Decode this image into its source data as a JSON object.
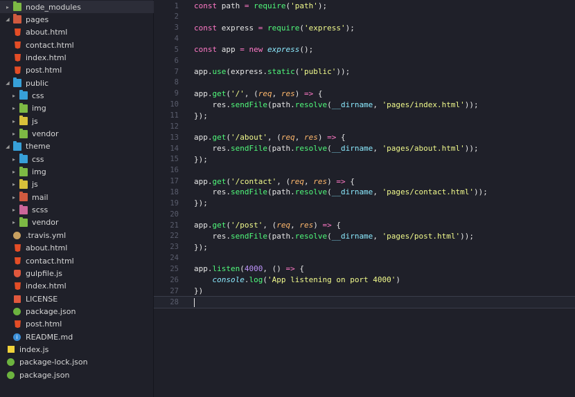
{
  "tree": [
    {
      "name": "node_modules",
      "type": "folder",
      "color": "green",
      "depth": 0,
      "expanded": false,
      "selected": true
    },
    {
      "name": "pages",
      "type": "folder",
      "color": "red",
      "depth": 0,
      "expanded": true
    },
    {
      "name": "about.html",
      "type": "html",
      "depth": 1
    },
    {
      "name": "contact.html",
      "type": "html",
      "depth": 1
    },
    {
      "name": "index.html",
      "type": "html",
      "depth": 1
    },
    {
      "name": "post.html",
      "type": "html",
      "depth": 1
    },
    {
      "name": "public",
      "type": "folder",
      "color": "blue",
      "depth": 0,
      "expanded": true
    },
    {
      "name": "css",
      "type": "folder",
      "color": "blue",
      "depth": 1,
      "expanded": false
    },
    {
      "name": "img",
      "type": "folder",
      "color": "green",
      "depth": 1,
      "expanded": false
    },
    {
      "name": "js",
      "type": "folder",
      "color": "yellow",
      "depth": 1,
      "expanded": false
    },
    {
      "name": "vendor",
      "type": "folder",
      "color": "green",
      "depth": 1,
      "expanded": false
    },
    {
      "name": "theme",
      "type": "folder",
      "color": "blue",
      "depth": 0,
      "expanded": true
    },
    {
      "name": "css",
      "type": "folder",
      "color": "blue",
      "depth": 1,
      "expanded": false
    },
    {
      "name": "img",
      "type": "folder",
      "color": "green",
      "depth": 1,
      "expanded": false
    },
    {
      "name": "js",
      "type": "folder",
      "color": "yellow",
      "depth": 1,
      "expanded": false
    },
    {
      "name": "mail",
      "type": "folder",
      "color": "red",
      "depth": 1,
      "expanded": false
    },
    {
      "name": "scss",
      "type": "folder",
      "color": "pink",
      "depth": 1,
      "expanded": false
    },
    {
      "name": "vendor",
      "type": "folder",
      "color": "green",
      "depth": 1,
      "expanded": false
    },
    {
      "name": ".travis.yml",
      "type": "travis",
      "depth": 1
    },
    {
      "name": "about.html",
      "type": "html",
      "depth": 1
    },
    {
      "name": "contact.html",
      "type": "html",
      "depth": 1
    },
    {
      "name": "gulpfile.js",
      "type": "gulp",
      "depth": 1
    },
    {
      "name": "index.html",
      "type": "html",
      "depth": 1
    },
    {
      "name": "LICENSE",
      "type": "license",
      "depth": 1
    },
    {
      "name": "package.json",
      "type": "json",
      "depth": 1
    },
    {
      "name": "post.html",
      "type": "html",
      "depth": 1
    },
    {
      "name": "README.md",
      "type": "info",
      "depth": 1
    },
    {
      "name": "index.js",
      "type": "js",
      "depth": 0
    },
    {
      "name": "package-lock.json",
      "type": "json",
      "depth": 0
    },
    {
      "name": "package.json",
      "type": "json",
      "depth": 0
    }
  ],
  "code_lines": [
    [
      [
        "kw",
        "const"
      ],
      [
        "pl",
        " path "
      ],
      [
        "op",
        "="
      ],
      [
        "pl",
        " "
      ],
      [
        "fn",
        "require"
      ],
      [
        "pl",
        "("
      ],
      [
        "str",
        "'path'"
      ],
      [
        "pl",
        ");"
      ]
    ],
    [],
    [
      [
        "kw",
        "const"
      ],
      [
        "pl",
        " express "
      ],
      [
        "op",
        "="
      ],
      [
        "pl",
        " "
      ],
      [
        "fn",
        "require"
      ],
      [
        "pl",
        "("
      ],
      [
        "str",
        "'express'"
      ],
      [
        "pl",
        ");"
      ]
    ],
    [],
    [
      [
        "kw",
        "const"
      ],
      [
        "pl",
        " app "
      ],
      [
        "op",
        "="
      ],
      [
        "pl",
        " "
      ],
      [
        "kw",
        "new"
      ],
      [
        "pl",
        " "
      ],
      [
        "cls",
        "express"
      ],
      [
        "pl",
        "();"
      ]
    ],
    [],
    [
      [
        "pl",
        "app."
      ],
      [
        "fn",
        "use"
      ],
      [
        "pl",
        "(express."
      ],
      [
        "fn",
        "static"
      ],
      [
        "pl",
        "("
      ],
      [
        "str",
        "'public'"
      ],
      [
        "pl",
        "));"
      ]
    ],
    [],
    [
      [
        "pl",
        "app."
      ],
      [
        "fn",
        "get"
      ],
      [
        "pl",
        "("
      ],
      [
        "str",
        "'/'"
      ],
      [
        "pl",
        ", ("
      ],
      [
        "param",
        "req"
      ],
      [
        "pl",
        ", "
      ],
      [
        "param",
        "res"
      ],
      [
        "pl",
        ") "
      ],
      [
        "op",
        "=>"
      ],
      [
        "pl",
        " {"
      ]
    ],
    [
      [
        "pl",
        "    res."
      ],
      [
        "fn",
        "sendFile"
      ],
      [
        "pl",
        "(path."
      ],
      [
        "fn",
        "resolve"
      ],
      [
        "pl",
        "("
      ],
      [
        "key",
        "__dirname"
      ],
      [
        "pl",
        ", "
      ],
      [
        "str",
        "'pages/index.html'"
      ],
      [
        "pl",
        "));"
      ]
    ],
    [
      [
        "pl",
        "});"
      ]
    ],
    [],
    [
      [
        "pl",
        "app."
      ],
      [
        "fn",
        "get"
      ],
      [
        "pl",
        "("
      ],
      [
        "str",
        "'/about'"
      ],
      [
        "pl",
        ", ("
      ],
      [
        "param",
        "req"
      ],
      [
        "pl",
        ", "
      ],
      [
        "param",
        "res"
      ],
      [
        "pl",
        ") "
      ],
      [
        "op",
        "=>"
      ],
      [
        "pl",
        " {"
      ]
    ],
    [
      [
        "pl",
        "    res."
      ],
      [
        "fn",
        "sendFile"
      ],
      [
        "pl",
        "(path."
      ],
      [
        "fn",
        "resolve"
      ],
      [
        "pl",
        "("
      ],
      [
        "key",
        "__dirname"
      ],
      [
        "pl",
        ", "
      ],
      [
        "str",
        "'pages/about.html'"
      ],
      [
        "pl",
        "));"
      ]
    ],
    [
      [
        "pl",
        "});"
      ]
    ],
    [],
    [
      [
        "pl",
        "app."
      ],
      [
        "fn",
        "get"
      ],
      [
        "pl",
        "("
      ],
      [
        "str",
        "'/contact'"
      ],
      [
        "pl",
        ", ("
      ],
      [
        "param",
        "req"
      ],
      [
        "pl",
        ", "
      ],
      [
        "param",
        "res"
      ],
      [
        "pl",
        ") "
      ],
      [
        "op",
        "=>"
      ],
      [
        "pl",
        " {"
      ]
    ],
    [
      [
        "pl",
        "    res."
      ],
      [
        "fn",
        "sendFile"
      ],
      [
        "pl",
        "(path."
      ],
      [
        "fn",
        "resolve"
      ],
      [
        "pl",
        "("
      ],
      [
        "key",
        "__dirname"
      ],
      [
        "pl",
        ", "
      ],
      [
        "str",
        "'pages/contact.html'"
      ],
      [
        "pl",
        "));"
      ]
    ],
    [
      [
        "pl",
        "});"
      ]
    ],
    [],
    [
      [
        "pl",
        "app."
      ],
      [
        "fn",
        "get"
      ],
      [
        "pl",
        "("
      ],
      [
        "str",
        "'/post'"
      ],
      [
        "pl",
        ", ("
      ],
      [
        "param",
        "req"
      ],
      [
        "pl",
        ", "
      ],
      [
        "param",
        "res"
      ],
      [
        "pl",
        ") "
      ],
      [
        "op",
        "=>"
      ],
      [
        "pl",
        " {"
      ]
    ],
    [
      [
        "pl",
        "    res."
      ],
      [
        "fn",
        "sendFile"
      ],
      [
        "pl",
        "(path."
      ],
      [
        "fn",
        "resolve"
      ],
      [
        "pl",
        "("
      ],
      [
        "key",
        "__dirname"
      ],
      [
        "pl",
        ", "
      ],
      [
        "str",
        "'pages/post.html'"
      ],
      [
        "pl",
        "));"
      ]
    ],
    [
      [
        "pl",
        "});"
      ]
    ],
    [],
    [
      [
        "pl",
        "app."
      ],
      [
        "fn",
        "listen"
      ],
      [
        "pl",
        "("
      ],
      [
        "num",
        "4000"
      ],
      [
        "pl",
        ", () "
      ],
      [
        "op",
        "=>"
      ],
      [
        "pl",
        " {"
      ]
    ],
    [
      [
        "pl",
        "    "
      ],
      [
        "cls",
        "console"
      ],
      [
        "pl",
        "."
      ],
      [
        "fn",
        "log"
      ],
      [
        "pl",
        "("
      ],
      [
        "str",
        "'App listening on port 4000'"
      ],
      [
        "pl",
        ")"
      ]
    ],
    [
      [
        "pl",
        "})"
      ]
    ],
    []
  ],
  "active_line": 28,
  "colors": {
    "background": "#1f2029",
    "keyword": "#ff79c6",
    "function": "#50fa7b",
    "string": "#f1fa8c",
    "number": "#bd93f9",
    "parameter": "#ffb86c",
    "builtin": "#8be9fd"
  }
}
